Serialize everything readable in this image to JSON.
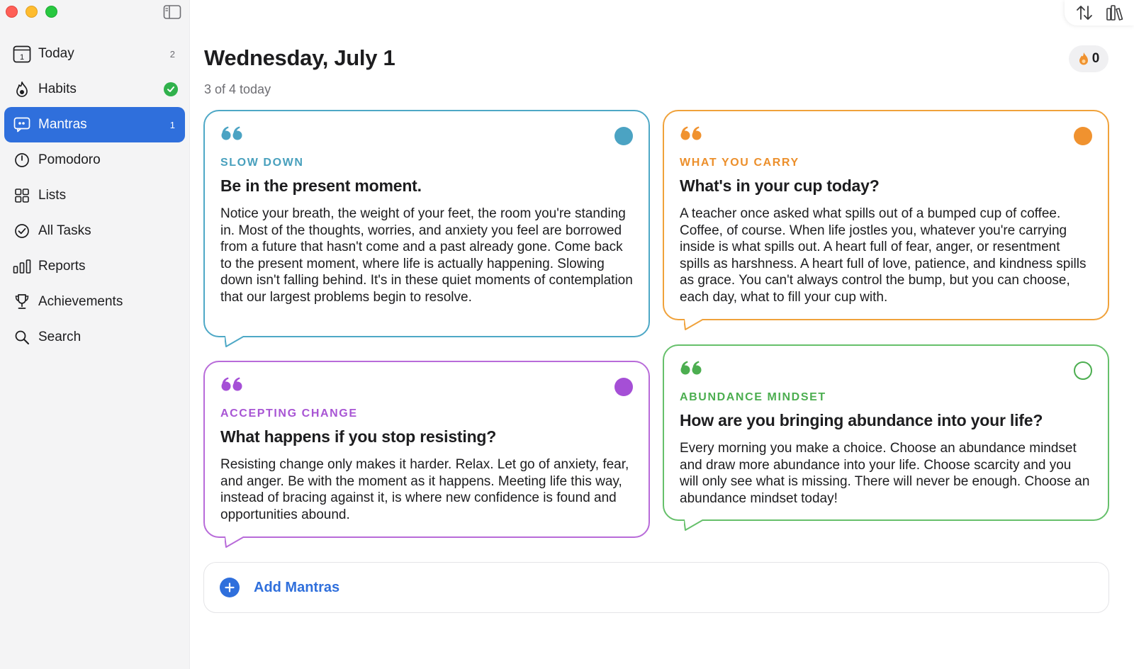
{
  "sidebar": {
    "items": [
      {
        "label": "Today",
        "icon": "calendar-day-icon",
        "icon_text": "1",
        "count": "2"
      },
      {
        "label": "Habits",
        "icon": "flame-icon"
      },
      {
        "label": "Mantras",
        "icon": "quote-bubble-icon",
        "count": "1",
        "active": true
      },
      {
        "label": "Pomodoro",
        "icon": "timer-icon"
      },
      {
        "label": "Lists",
        "icon": "grid-icon"
      },
      {
        "label": "All Tasks",
        "icon": "checkmark-circle-icon"
      },
      {
        "label": "Reports",
        "icon": "bar-chart-icon"
      },
      {
        "label": "Achievements",
        "icon": "trophy-icon"
      },
      {
        "label": "Search",
        "icon": "search-icon"
      }
    ]
  },
  "header": {
    "title": "Wednesday, July 1",
    "subtitle": "3 of 4 today",
    "streak_count": "0"
  },
  "colors": {
    "accent": "#2f6fdc",
    "blue": "#4ba3c3",
    "orange": "#f0922f",
    "purple": "#a54fd6",
    "green": "#4cae50"
  },
  "mantras": [
    {
      "category": "SLOW DOWN",
      "title": "Be in the present moment.",
      "body": "Notice your breath, the weight of your feet, the room you're standing in. Most of the thoughts, worries, and anxiety you feel are borrowed from a future that hasn't come and a past already gone. Come back to the present moment, where life is actually happening. Slowing down isn't falling behind. It's in these quiet moments of contemplation that our largest problems begin to resolve.",
      "color": "#4ba3c3",
      "completed": true
    },
    {
      "category": "WHAT YOU CARRY",
      "title": "What's in your cup today?",
      "body": "A teacher once asked what spills out of a bumped cup of coffee. Coffee, of course. When life jostles you, whatever you're carrying inside is what spills out. A heart full of fear, anger, or resentment spills as harshness. A heart full of love, patience, and kindness spills as grace. You can't always control the bump, but you can choose, each day, what to fill your cup with.",
      "color": "#f0922f",
      "completed": true
    },
    {
      "category": "ACCEPTING CHANGE",
      "title": "What happens if you stop resisting?",
      "body": "Resisting change only makes it harder. Relax. Let go of anxiety, fear, and anger. Be with the moment as it happens. Meeting life this way, instead of bracing against it, is where new confidence is found and opportunities abound.",
      "color": "#a54fd6",
      "completed": true
    },
    {
      "category": "ABUNDANCE MINDSET",
      "title": "How are you bringing abundance into your life?",
      "body": "Every morning you make a choice. Choose an abundance mindset and draw more abundance into your life. Choose scarcity and you will only see what is missing. There will never be enough. Choose an abundance mindset today!",
      "color": "#4cae50",
      "completed": false
    }
  ],
  "add_button": {
    "label": "Add Mantras"
  },
  "toolbar": {
    "sort_icon": "sort-arrows-icon",
    "library_icon": "library-icon"
  }
}
